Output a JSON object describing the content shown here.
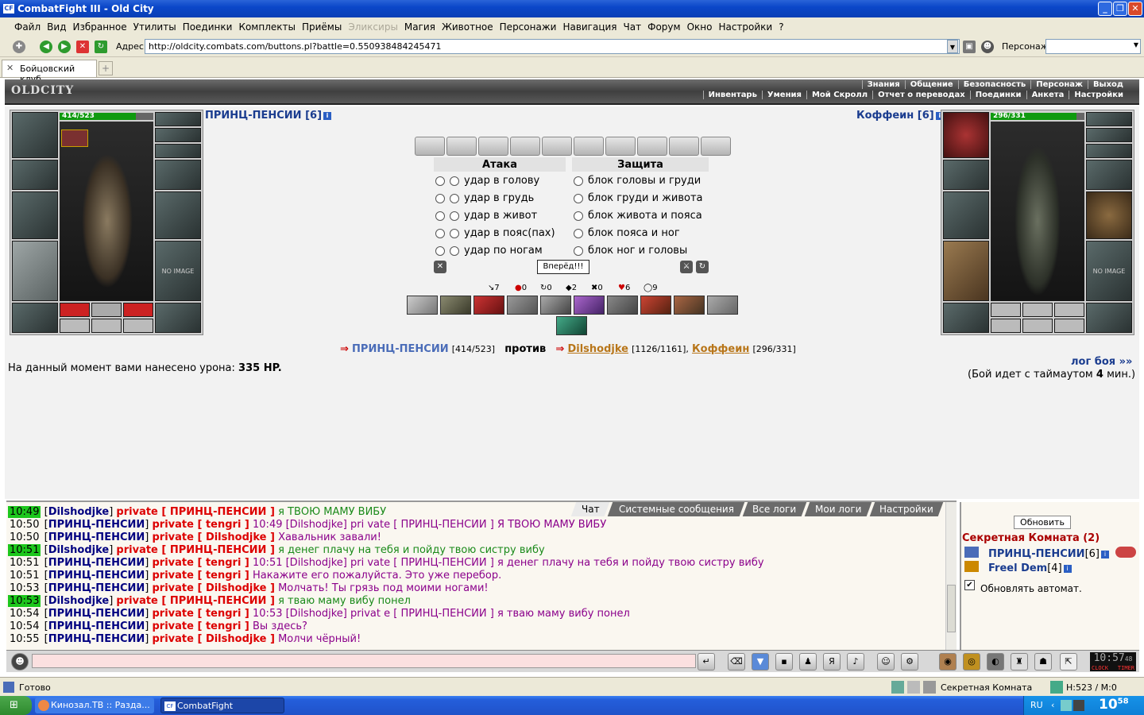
{
  "window": {
    "title": "CombatFight III - Old City",
    "logo": "CF"
  },
  "menu": [
    "Файл",
    "Вид",
    "Избранное",
    "Утилиты",
    "Поединки",
    "Комплекты",
    "Приёмы",
    "Эликсиры",
    "Магия",
    "Животное",
    "Персонажи",
    "Навигация",
    "Чат",
    "Форум",
    "Окно",
    "Настройки",
    "?"
  ],
  "menu_disabled": "Эликсиры",
  "address": {
    "label": "Адрес:",
    "url": "http://oldcity.combats.com/buttons.pl?battle=0.550938484245471",
    "persona_label": "Персонаж:"
  },
  "tab": {
    "label": "Бойцовский клуб"
  },
  "game_header": {
    "logo": "OLDCITY",
    "nav_top": [
      "Знания",
      "Общение",
      "Безопасность",
      "Персонаж",
      "Выход"
    ],
    "nav_bottom": [
      "Инвентарь",
      "Умения",
      "Мой Скролл",
      "Отчет о переводах",
      "Поединки",
      "Анкета",
      "Настройки"
    ]
  },
  "player_left": {
    "name": "ПРИНЦ-ПЕНСИИ [6]",
    "hp": "414/523",
    "hp_fraction": 0.79
  },
  "player_right": {
    "name": "Коффеин [6]",
    "hp": "296/331",
    "hp_fraction": 0.89,
    "no_image": "NO IMAGE"
  },
  "left_no_image": "NO IMAGE",
  "attack": {
    "header": "Атака",
    "rows": [
      "удар в голову",
      "удар в грудь",
      "удар в живот",
      "удар в пояс(пах)",
      "удар по ногам"
    ]
  },
  "defense": {
    "header": "Защита",
    "rows": [
      "блок головы и груди",
      "блок груди и живота",
      "блок живота и пояса",
      "блок пояса и ног",
      "блок ног и головы"
    ]
  },
  "forward_button": "Вперёд!!!",
  "stats": [
    {
      "icon": "↘",
      "value": "7"
    },
    {
      "icon": "●",
      "value": "0"
    },
    {
      "icon": "↻",
      "value": "0"
    },
    {
      "icon": "◆",
      "value": "2"
    },
    {
      "icon": "✖",
      "value": "0"
    },
    {
      "icon": "♥",
      "value": "6"
    },
    {
      "icon": "◯",
      "value": "9"
    }
  ],
  "battle_line": {
    "p1": "ПРИНЦ-ПЕНСИИ",
    "p1_hp": "[414/523]",
    "vs": "против",
    "p2": "Dilshodjke",
    "p2_hp": "[1126/1161],",
    "p3": "Коффеин",
    "p3_hp": "[296/331]"
  },
  "damage": {
    "text": "На данный момент вами нанесено урона:",
    "value": "335 HP."
  },
  "battle_log": {
    "link": "лог боя »»",
    "timeout_pre": "(Бой идет с таймаутом",
    "timeout_value": "4",
    "timeout_post": "мин.)"
  },
  "chat_tabs": [
    "Чат",
    "Системные сообщения",
    "Все логи",
    "Мои логи",
    "Настройки"
  ],
  "chat": [
    {
      "time": "10:49",
      "hl": true,
      "user": "Dilshodjke",
      "target": "ПРИНЦ-ПЕНСИИ",
      "msg": "я ТВОЮ МАМУ ВИБУ",
      "msgcolor": "#1a8a1a"
    },
    {
      "time": "10:50",
      "hl": false,
      "user": "ПРИНЦ-ПЕНСИИ",
      "target": "tengri",
      "msg": "10:49 [Dilshodjke] pri vate [ ПРИНЦ-ПЕНСИИ ] Я ТВОЮ МАМУ ВИБУ",
      "msgcolor": "#8b008b"
    },
    {
      "time": "10:50",
      "hl": false,
      "user": "ПРИНЦ-ПЕНСИИ",
      "target": "Dilshodjke",
      "msg": "Хавальник завали!",
      "msgcolor": "#8b008b"
    },
    {
      "time": "10:51",
      "hl": true,
      "user": "Dilshodjke",
      "target": "ПРИНЦ-ПЕНСИИ",
      "msg": "я денег плачу на тебя и пойду твою систру вибу",
      "msgcolor": "#1a8a1a"
    },
    {
      "time": "10:51",
      "hl": false,
      "user": "ПРИНЦ-ПЕНСИИ",
      "target": "tengri",
      "msg": "10:51 [Dilshodjke] pri vate [ ПРИНЦ-ПЕНСИИ ] я денег плачу на тебя и пойду твою систру вибу",
      "msgcolor": "#8b008b"
    },
    {
      "time": "10:51",
      "hl": false,
      "user": "ПРИНЦ-ПЕНСИИ",
      "target": "tengri",
      "msg": "Накажите его пожалуйста. Это уже перебор.",
      "msgcolor": "#8b008b"
    },
    {
      "time": "10:53",
      "hl": false,
      "user": "ПРИНЦ-ПЕНСИИ",
      "target": "Dilshodjke",
      "msg": "Молчать! Ты грязь под моими ногами!",
      "msgcolor": "#8b008b"
    },
    {
      "time": "10:53",
      "hl": true,
      "user": "Dilshodjke",
      "target": "ПРИНЦ-ПЕНСИИ",
      "msg": "я тваю маму вибу понел",
      "msgcolor": "#1a8a1a"
    },
    {
      "time": "10:54",
      "hl": false,
      "user": "ПРИНЦ-ПЕНСИИ",
      "target": "tengri",
      "msg": "10:53 [Dilshodjke] privat e [ ПРИНЦ-ПЕНСИИ ] я тваю маму вибу понел",
      "msgcolor": "#8b008b"
    },
    {
      "time": "10:54",
      "hl": false,
      "user": "ПРИНЦ-ПЕНСИИ",
      "target": "tengri",
      "msg": "Вы здесь?",
      "msgcolor": "#8b008b"
    },
    {
      "time": "10:55",
      "hl": false,
      "user": "ПРИНЦ-ПЕНСИИ",
      "target": "Dilshodjke",
      "msg": "Молчи чёрный!",
      "msgcolor": "#8b008b"
    }
  ],
  "chat_private_word": "private",
  "side": {
    "refresh": "Обновить",
    "room": "Секретная Комната (2)",
    "users": [
      {
        "name": "ПРИНЦ-ПЕНСИИ",
        "level": "[6]"
      },
      {
        "name": "Freel Dem",
        "level": "[4]"
      }
    ],
    "auto": "Обновлять автомат."
  },
  "clock": {
    "time": "10:57",
    "sec": "48",
    "labels": [
      "CLOCK",
      "TIMER"
    ]
  },
  "status": {
    "ready": "Готово",
    "room": "Секретная Комната",
    "hm": "H:523 / M:0"
  },
  "taskbar": {
    "items": [
      "Кинозал.ТВ :: Разда...",
      "CombatFight"
    ],
    "lang": "RU",
    "time": "10",
    "time_min": "58"
  }
}
